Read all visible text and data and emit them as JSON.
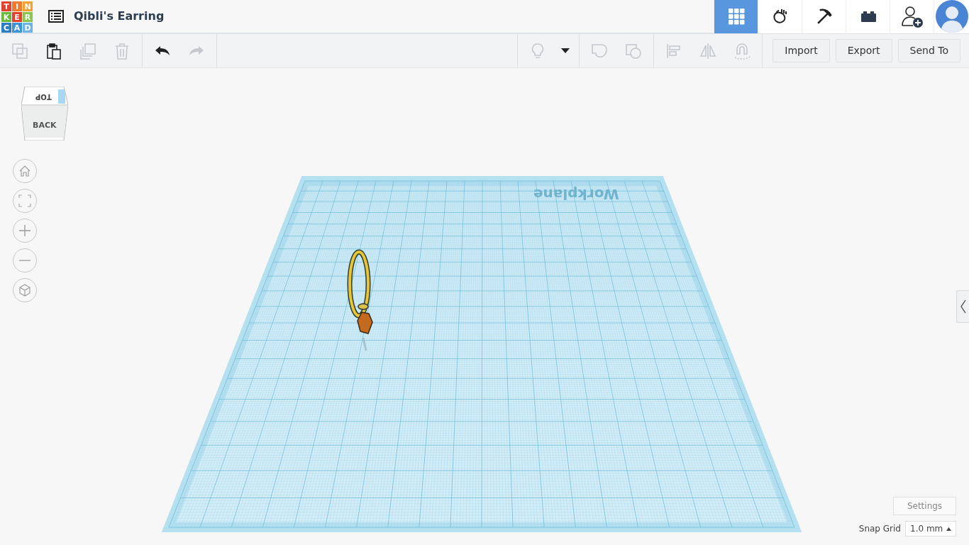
{
  "logo": {
    "letters": [
      {
        "char": "T",
        "color": "#e2412b"
      },
      {
        "char": "I",
        "color": "#f27a2f"
      },
      {
        "char": "N",
        "color": "#f2a133"
      },
      {
        "char": "K",
        "color": "#6cba3c"
      },
      {
        "char": "E",
        "color": "#e2412b"
      },
      {
        "char": "R",
        "color": "#87c74f"
      },
      {
        "char": "C",
        "color": "#2b7ec1"
      },
      {
        "char": "A",
        "color": "#3d92d2"
      },
      {
        "char": "D",
        "color": "#6ab4e6"
      }
    ]
  },
  "title": "Qibli's Earring",
  "header_nav": [
    {
      "kind": "grid",
      "selected": true
    },
    {
      "kind": "blob",
      "selected": false
    },
    {
      "kind": "pickaxe",
      "selected": false
    },
    {
      "kind": "brick",
      "selected": false
    },
    {
      "kind": "add-user",
      "selected": false
    }
  ],
  "toolbar": {
    "left_groups": [
      [
        {
          "kind": "copy",
          "disabled": true
        },
        {
          "kind": "paste",
          "disabled": false
        },
        {
          "kind": "duplicate",
          "disabled": true
        },
        {
          "kind": "delete",
          "disabled": true
        }
      ],
      [
        {
          "kind": "undo",
          "disabled": false
        },
        {
          "kind": "redo",
          "disabled": true
        }
      ]
    ],
    "right_groups": [
      [
        {
          "kind": "bulb",
          "disabled": true
        },
        {
          "kind": "dropdown",
          "disabled": false
        }
      ],
      [
        {
          "kind": "group",
          "disabled": true
        },
        {
          "kind": "hole",
          "disabled": true
        }
      ],
      [
        {
          "kind": "align",
          "disabled": true
        },
        {
          "kind": "mirror",
          "disabled": true
        },
        {
          "kind": "magnet",
          "disabled": true
        }
      ]
    ],
    "buttons": [
      "Import",
      "Export",
      "Send To"
    ]
  },
  "view_cube": {
    "top": "TOP",
    "front": "BACK"
  },
  "view_controls": [
    {
      "kind": "home"
    },
    {
      "kind": "fit"
    },
    {
      "kind": "zoom-in"
    },
    {
      "kind": "zoom-out"
    },
    {
      "kind": "ortho"
    }
  ],
  "workplane": {
    "label": "Workplane"
  },
  "settings_button": "Settings",
  "snap_grid": {
    "label": "Snap Grid",
    "value": "1.0 mm"
  }
}
